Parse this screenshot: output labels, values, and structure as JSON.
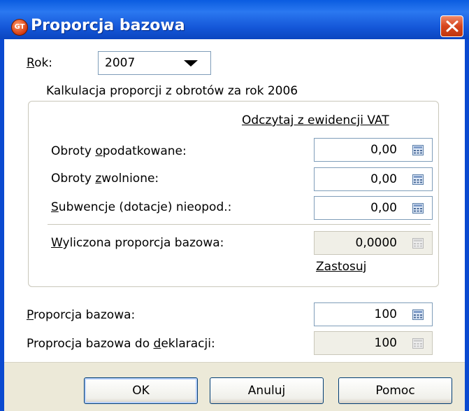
{
  "window": {
    "title": "Proporcja bazowa",
    "app_icon_text": "GT"
  },
  "rok": {
    "label": "Rok:",
    "value": "2007"
  },
  "group": {
    "legend": "Kalkulacja proporcji z obrotów za rok 2006",
    "read_link": "Odczytaj z ewidencji VAT",
    "fields": [
      {
        "label": "Obroty opodatkowane:",
        "value": "0,00"
      },
      {
        "label": "Obroty zwolnione:",
        "value": "0,00"
      },
      {
        "label": "Subwencje (dotacje) nieopod.:",
        "value": "0,00"
      }
    ],
    "computed": {
      "label": "Wyliczona proporcja bazowa:",
      "value": "0,0000"
    },
    "apply_link": "Zastosuj"
  },
  "proporcja": {
    "label": "Proporcja bazowa:",
    "value": "100"
  },
  "deklaracja": {
    "label": "Proprocja bazowa do deklaracji:",
    "value": "100"
  },
  "buttons": {
    "ok": "OK",
    "cancel": "Anuluj",
    "help": "Pomoc"
  }
}
